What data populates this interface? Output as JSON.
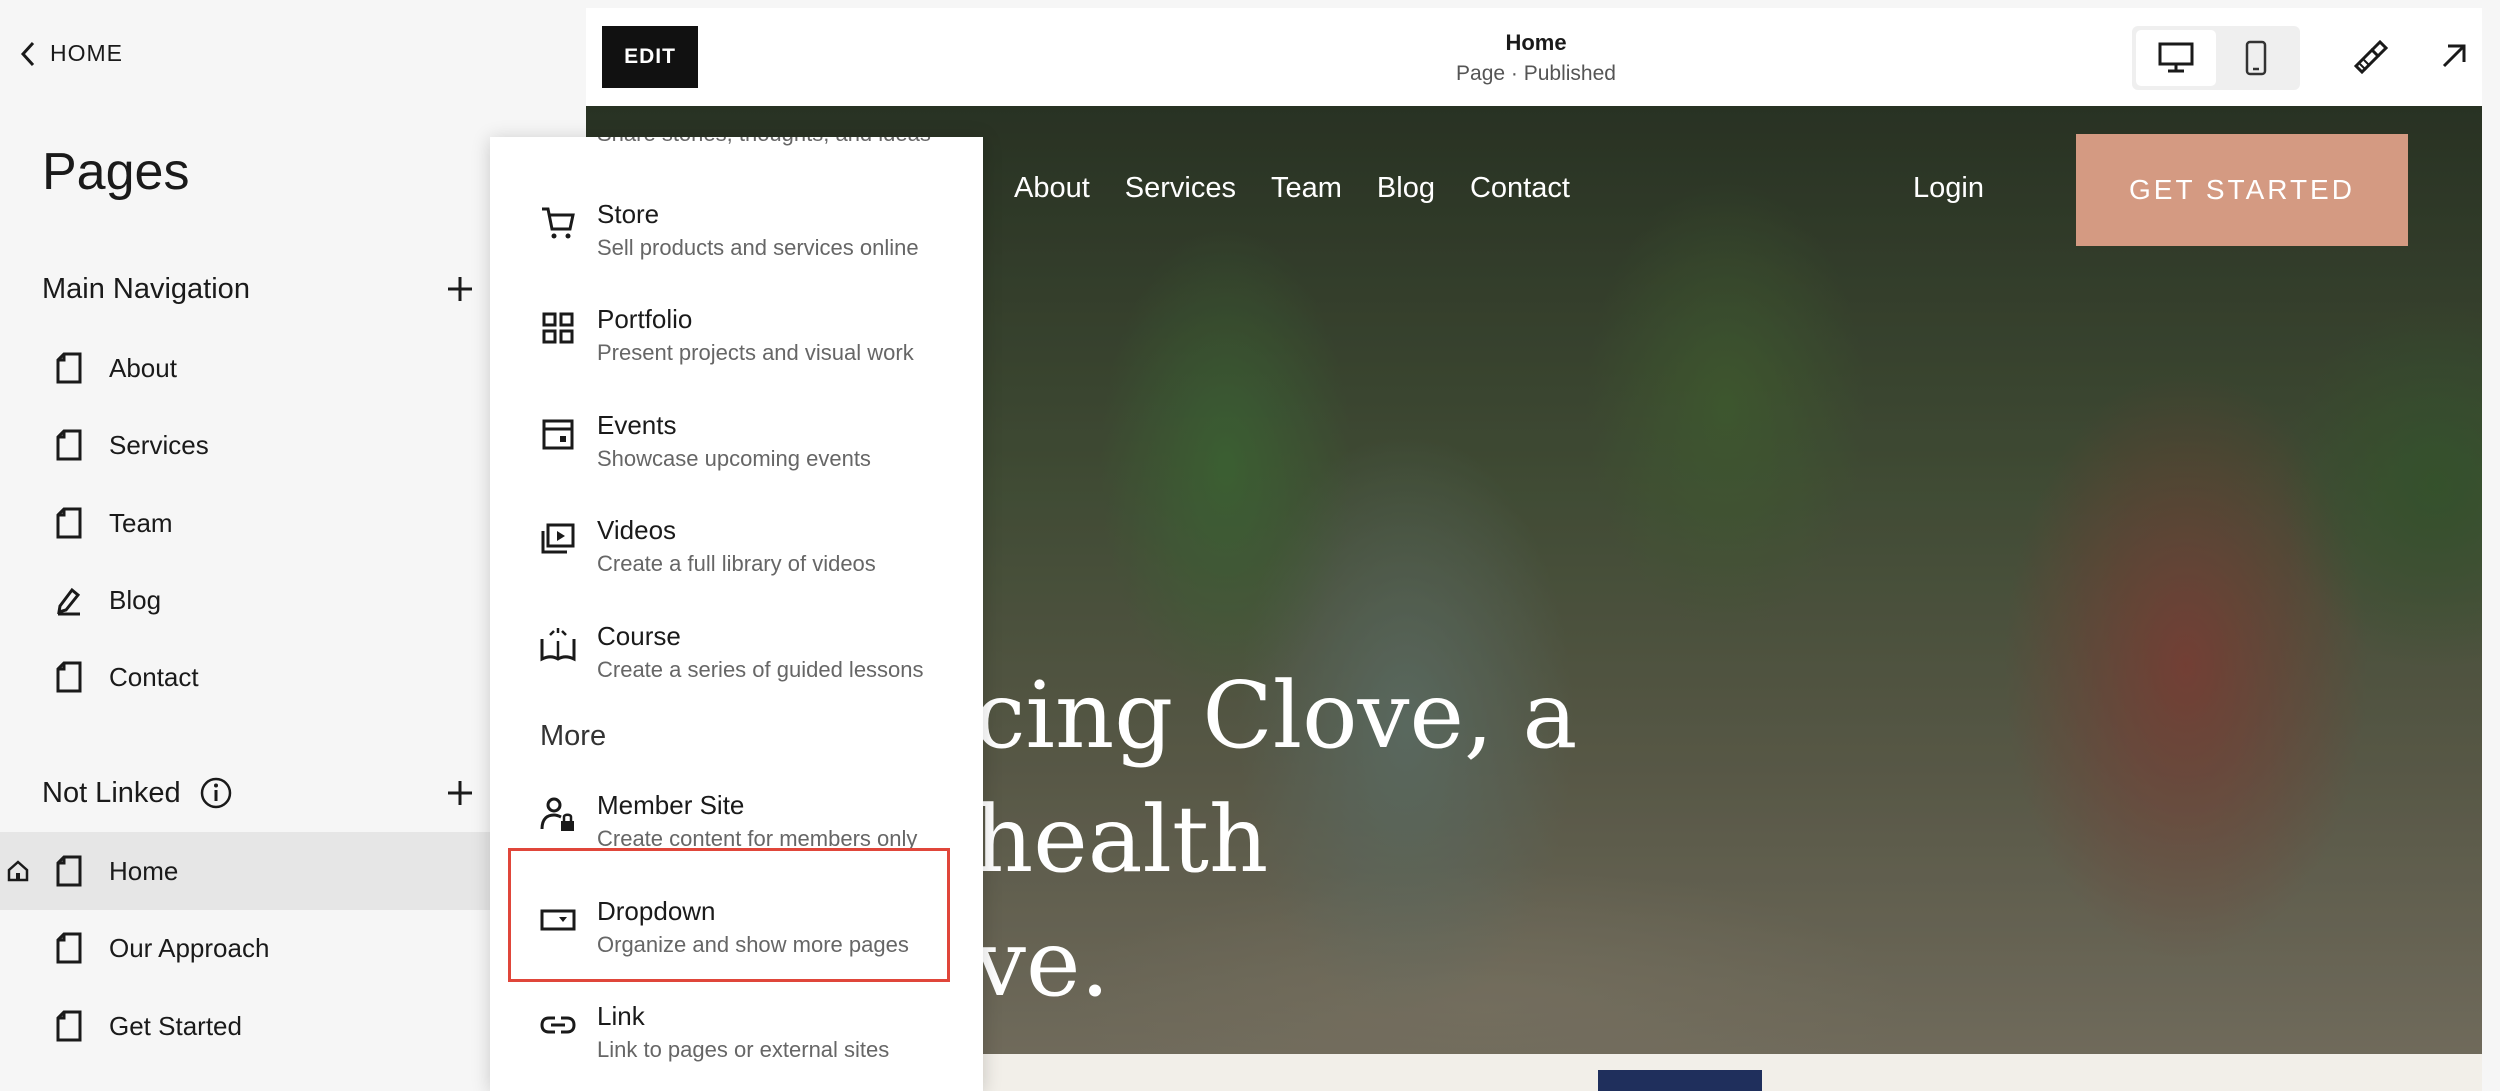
{
  "sidebar": {
    "home_link": "HOME",
    "title": "Pages",
    "main_nav": {
      "label": "Main Navigation",
      "items": [
        {
          "label": "About",
          "icon": "page-icon"
        },
        {
          "label": "Services",
          "icon": "page-icon"
        },
        {
          "label": "Team",
          "icon": "page-icon"
        },
        {
          "label": "Blog",
          "icon": "blog-icon"
        },
        {
          "label": "Contact",
          "icon": "page-icon"
        }
      ]
    },
    "not_linked": {
      "label": "Not Linked",
      "items": [
        {
          "label": "Home",
          "icon": "page-icon",
          "selected": true,
          "is_homepage": true
        },
        {
          "label": "Our Approach",
          "icon": "page-icon"
        },
        {
          "label": "Get Started",
          "icon": "page-icon"
        }
      ]
    }
  },
  "topbar": {
    "edit_label": "EDIT",
    "page_name": "Home",
    "page_status": "Page · Published",
    "active_device": "desktop"
  },
  "preview": {
    "nav": [
      "About",
      "Services",
      "Team",
      "Blog",
      "Contact"
    ],
    "login": "Login",
    "cta": "GET STARTED",
    "headline_lines": [
      "cing Clove, a",
      "health",
      "ve."
    ]
  },
  "menu": {
    "cut_off_desc": "Share stories, thoughts, and ideas",
    "items": [
      {
        "title": "Store",
        "desc": "Sell products and services online",
        "icon": "cart-icon"
      },
      {
        "title": "Portfolio",
        "desc": "Present projects and visual work",
        "icon": "grid-icon"
      },
      {
        "title": "Events",
        "desc": "Showcase upcoming events",
        "icon": "calendar-icon"
      },
      {
        "title": "Videos",
        "desc": "Create a full library of videos",
        "icon": "video-icon"
      },
      {
        "title": "Course",
        "desc": "Create a series of guided lessons",
        "icon": "book-icon"
      }
    ],
    "more_label": "More",
    "more_items": [
      {
        "title": "Member Site",
        "desc": "Create content for members only",
        "icon": "member-lock-icon"
      },
      {
        "title": "Dropdown",
        "desc": "Organize and show more pages",
        "icon": "dropdown-icon",
        "highlighted": true
      },
      {
        "title": "Link",
        "desc": "Link to pages or external sites",
        "icon": "link-icon"
      }
    ]
  },
  "colors": {
    "accent_cta": "#d49a82",
    "highlight_border": "#e0463a",
    "edit_button_bg": "#111111"
  }
}
